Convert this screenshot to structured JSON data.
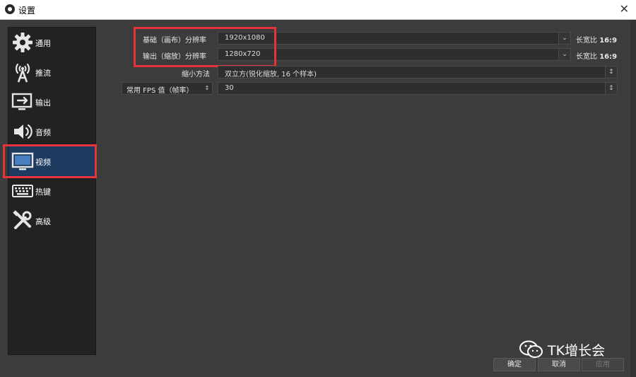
{
  "window": {
    "title": "设置",
    "close_glyph": "✕"
  },
  "sidebar": {
    "items": [
      {
        "label": "通用",
        "icon": "gear-icon"
      },
      {
        "label": "推流",
        "icon": "broadcast-antenna-icon"
      },
      {
        "label": "输出",
        "icon": "output-monitor-icon"
      },
      {
        "label": "音频",
        "icon": "speaker-icon"
      },
      {
        "label": "视频",
        "icon": "monitor-icon",
        "selected": true
      },
      {
        "label": "热键",
        "icon": "keyboard-icon"
      },
      {
        "label": "高级",
        "icon": "tools-icon"
      }
    ]
  },
  "video": {
    "base_resolution": {
      "label": "基础（画布）分辨率",
      "value": "1920x1080",
      "aspect_label": "长宽比",
      "aspect_value": "16:9"
    },
    "output_resolution": {
      "label": "输出（缩放）分辨率",
      "value": "1280x720",
      "aspect_label": "长宽比",
      "aspect_value": "16:9"
    },
    "downscale_filter": {
      "label": "缩小方法",
      "value": "双立方(锐化缩放, 16 个样本)"
    },
    "fps": {
      "label": "常用 FPS 值（帧率）",
      "value": "30"
    }
  },
  "buttons": {
    "ok": "确定",
    "cancel": "取消",
    "apply": "应用"
  },
  "watermark": {
    "text": "TK增长会",
    "icon": "wechat-icon"
  },
  "colors": {
    "highlight": "#e8333b",
    "selected_bg": "#1e3a5f",
    "panel_bg": "#3c3c3c",
    "sidebar_bg": "#222222"
  }
}
